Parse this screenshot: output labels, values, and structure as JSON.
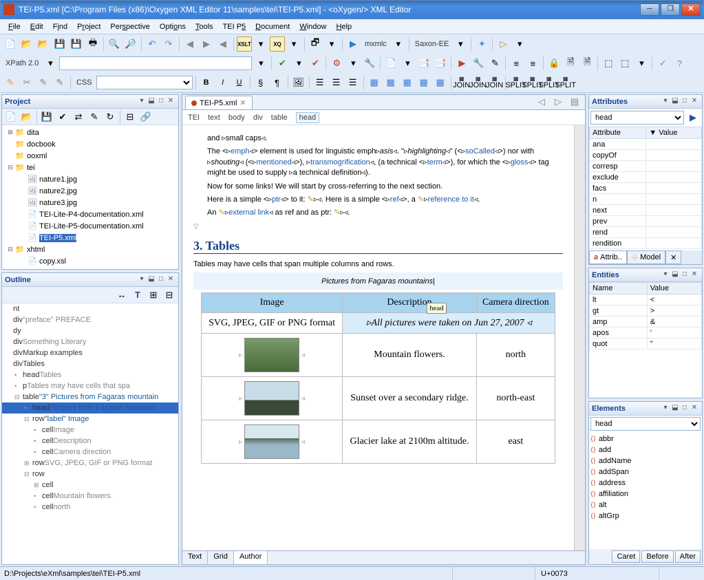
{
  "window": {
    "title": "TEI-P5.xml [C:\\Program Files (x86)\\Oxygen XML Editor 11\\samples\\tei\\TEI-P5.xml] - <oXygen/> XML Editor"
  },
  "menu": [
    "File",
    "Edit",
    "Find",
    "Project",
    "Perspective",
    "Options",
    "Tools",
    "TEI P5",
    "Document",
    "Window",
    "Help"
  ],
  "toolbar2": {
    "xpath": "XPath 2.0",
    "xpath_val": ""
  },
  "toolbar3": {
    "engine1": "mxmlc",
    "engine2": "Saxon-EE"
  },
  "css_label": "CSS",
  "css_val": "",
  "project": {
    "title": "Project",
    "tree": [
      {
        "ind": 0,
        "exp": "+",
        "icon": "fold",
        "label": "dita"
      },
      {
        "ind": 0,
        "exp": "",
        "icon": "fold",
        "label": "docbook"
      },
      {
        "ind": 0,
        "exp": "",
        "icon": "fold",
        "label": "ooxml"
      },
      {
        "ind": 0,
        "exp": "−",
        "icon": "fold",
        "label": "tei"
      },
      {
        "ind": 1,
        "exp": "",
        "icon": "img",
        "label": "nature1.jpg"
      },
      {
        "ind": 1,
        "exp": "",
        "icon": "img",
        "label": "nature2.jpg"
      },
      {
        "ind": 1,
        "exp": "",
        "icon": "img",
        "label": "nature3.jpg"
      },
      {
        "ind": 1,
        "exp": "",
        "icon": "xml",
        "label": "TEI-Lite-P4-documentation.xml"
      },
      {
        "ind": 1,
        "exp": "",
        "icon": "xml",
        "label": "TEI-Lite-P5-documentation.xml"
      },
      {
        "ind": 1,
        "exp": "",
        "icon": "xml",
        "label": "TEI-P5.xml",
        "sel": true
      },
      {
        "ind": 0,
        "exp": "−",
        "icon": "fold",
        "label": "xhtml"
      },
      {
        "ind": 1,
        "exp": "",
        "icon": "xml",
        "label": "copy.xsl"
      }
    ]
  },
  "outline": {
    "title": "Outline",
    "items": [
      {
        "ind": 0,
        "t": "nt",
        "cls": "on"
      },
      {
        "ind": 0,
        "t": "div",
        "s": "\"preface\" PREFACE",
        "cls": "og"
      },
      {
        "ind": 0,
        "t": "dy",
        "cls": "on"
      },
      {
        "ind": 0,
        "t": "div",
        "s": "Something Literary",
        "cls": "og"
      },
      {
        "ind": 0,
        "t": "div",
        "s": "Markup examples",
        "cls": "on"
      },
      {
        "ind": 0,
        "t": "div",
        "s": "Tables",
        "cls": "on"
      },
      {
        "ind": 1,
        "exp": "",
        "t": "head",
        "s": "Tables",
        "cls": "og"
      },
      {
        "ind": 1,
        "exp": "",
        "t": "p",
        "s": "Tables may have cells that spa",
        "cls": "og"
      },
      {
        "ind": 1,
        "exp": "−",
        "t": "table",
        "s": "\"3\" Pictures from Fagaras mountain",
        "cls": "ob"
      },
      {
        "ind": 2,
        "exp": "",
        "t": "head",
        "s": "Pictures from Fagaras mountain",
        "cls": "ob",
        "sel": true
      },
      {
        "ind": 2,
        "exp": "−",
        "t": "row",
        "s": "\"label\" Image",
        "cls": "ob"
      },
      {
        "ind": 3,
        "exp": "",
        "t": "cell",
        "s": "Image",
        "cls": "og"
      },
      {
        "ind": 3,
        "exp": "",
        "t": "cell",
        "s": "Description",
        "cls": "og"
      },
      {
        "ind": 3,
        "exp": "",
        "t": "cell",
        "s": "Camera direction",
        "cls": "og"
      },
      {
        "ind": 2,
        "exp": "+",
        "t": "row",
        "s": "SVG, JPEG, GIF or PNG format",
        "cls": "og"
      },
      {
        "ind": 2,
        "exp": "−",
        "t": "row",
        "cls": "on"
      },
      {
        "ind": 3,
        "exp": "+",
        "t": "cell",
        "cls": "on"
      },
      {
        "ind": 3,
        "exp": "",
        "t": "cell",
        "s": "Mountain flowers.",
        "cls": "og"
      },
      {
        "ind": 3,
        "exp": "",
        "t": "cell",
        "s": "north",
        "cls": "og"
      }
    ]
  },
  "editor": {
    "tab": "TEI-P5.xml",
    "breadcrumb": [
      "TEI",
      "text",
      "body",
      "div",
      "table",
      "head"
    ],
    "para_smallcaps": "and ▹small caps◃.",
    "para_emph": {
      "p1": "The <▹",
      "t1": "emph",
      "p2": "◃> element is used for linguistic emph▹",
      "e1": "asis",
      "p3": "◃. \"▹",
      "e2": "highlighting",
      "p4": "◃\" (<▹",
      "t2": "soCalled",
      "p5": "◃>) nor with ▹",
      "e3": "shouting",
      "p6": "◃ (<▹",
      "t3": "mentioned",
      "p7": "◃>), ▹",
      "t4": "transmogrification",
      "p8": "◃, (a technical <▹",
      "t5": "term",
      "p9": "◃>), for which the <▹",
      "t6": "gloss",
      "p10": "◃> tag might be used to supply ▹a technical definition◃)."
    },
    "para_links": "Now for some links! We will start by cross-referring to the next section.",
    "para_ptr": {
      "p1": "Here is a simple <▹",
      "t1": "ptr",
      "p2": "◃> to it: ",
      "p3": "▹◃. Here is a simple <▹",
      "t2": "ref",
      "p4": "◃>, a ",
      "p5": "▹",
      "t3": "reference to it",
      "p6": "◃."
    },
    "para_ext": {
      "p1": "An ",
      "p2": "▹",
      "t1": "external link",
      "p3": "◃ as ref and as ptr: ",
      "p4": "▹◃."
    },
    "h3": "3. Tables",
    "tbl_intro": "Tables may have cells that span multiple columns and rows.",
    "tooltip": "head",
    "caption": "Pictures from Fagaras mountains",
    "th": [
      "Image",
      "Description",
      "Camera direction"
    ],
    "r0": {
      "c0": "SVG, JPEG, GIF or PNG format",
      "note": "▹All pictures were taken on Jun 27, 2007 ◃"
    },
    "r1": {
      "d": "Mountain flowers.",
      "dir": "north"
    },
    "r2": {
      "d": "Sunset over a secondary ridge.",
      "dir": "north-east"
    },
    "r3": {
      "d": "Glacier lake at 2100m altitude.",
      "dir": "east"
    },
    "btabs": [
      "Text",
      "Grid",
      "Author"
    ]
  },
  "attributes": {
    "title": "Attributes",
    "element": "head",
    "cols": [
      "Attribute",
      "Value"
    ],
    "rows": [
      "ana",
      "copyOf",
      "corresp",
      "exclude",
      "facs",
      "n",
      "next",
      "prev",
      "rend",
      "rendition"
    ],
    "tabs": [
      "Attrib..",
      "Model"
    ]
  },
  "entities": {
    "title": "Entities",
    "cols": [
      "Name",
      "Value"
    ],
    "rows": [
      [
        "lt",
        "<"
      ],
      [
        "gt",
        ">"
      ],
      [
        "amp",
        "&"
      ],
      [
        "apos",
        "'"
      ],
      [
        "quot",
        "\""
      ]
    ]
  },
  "elements": {
    "title": "Elements",
    "element": "head",
    "list": [
      "abbr",
      "add",
      "addName",
      "addSpan",
      "address",
      "affiliation",
      "alt",
      "altGrp"
    ],
    "btns": [
      "Caret",
      "Before",
      "After"
    ]
  },
  "status": {
    "path": "D:\\Projects\\eXml\\samples\\tei\\TEI-P5.xml",
    "code": "U+0073"
  }
}
